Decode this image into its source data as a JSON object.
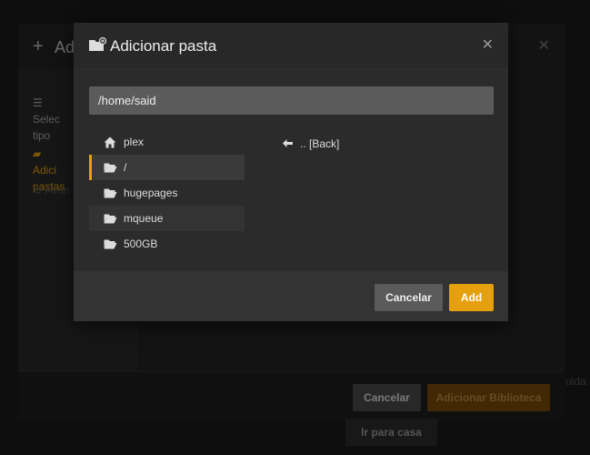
{
  "background_dialog": {
    "title": "Adi",
    "sidebar": {
      "items": [
        {
          "label": "Selec\ntipo",
          "icon": "list-icon"
        },
        {
          "label": "Adici\npastas",
          "icon": "folder-open-icon"
        },
        {
          "label": "Avan",
          "icon": "gear-icon"
        }
      ]
    },
    "cancel_label": "Cancelar",
    "add_label": "Adicionar Biblioteca",
    "trailing_text": "uida"
  },
  "home_button": "Ir para casa",
  "modal": {
    "title": "Adicionar pasta",
    "path_value": "/home/said",
    "directories": [
      {
        "label": "plex",
        "icon": "home-icon"
      },
      {
        "label": "/",
        "icon": "folder-open-icon",
        "selected": true
      },
      {
        "label": "hugepages",
        "icon": "folder-open-icon"
      },
      {
        "label": "mqueue",
        "icon": "folder-open-icon",
        "highlighted": true
      },
      {
        "label": "500GB",
        "icon": "folder-open-icon"
      }
    ],
    "back_label": ".. [Back]",
    "cancel_label": "Cancelar",
    "add_label": "Add"
  },
  "colors": {
    "accent": "#e5a00d",
    "modal_bg": "#282828",
    "input_bg": "#5b5b5b"
  }
}
